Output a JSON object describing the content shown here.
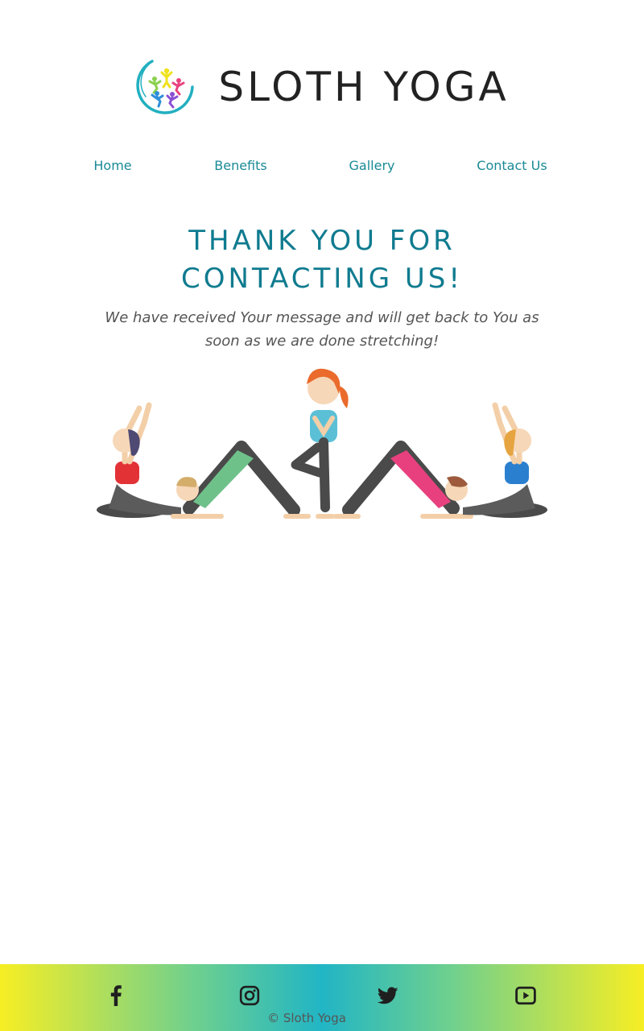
{
  "header": {
    "brand_name": "SLOTH YOGA",
    "logo_icon": "yoga-people-circle-logo"
  },
  "nav": {
    "items": [
      {
        "label": "Home"
      },
      {
        "label": "Benefits"
      },
      {
        "label": "Gallery"
      },
      {
        "label": "Contact Us"
      }
    ]
  },
  "main": {
    "heading": "THANK YOU FOR CONTACTING US!",
    "message": "We have received Your message and will get back to You as soon as we are done stretching!",
    "illustration": "five-women-yoga-poses-illustration"
  },
  "footer": {
    "social_icons": [
      "facebook-icon",
      "instagram-icon",
      "twitter-icon",
      "youtube-icon"
    ],
    "copyright": "© Sloth Yoga"
  },
  "colors": {
    "accent": "#1a8a96",
    "heading": "#0f7b8f",
    "brand_text": "#222222",
    "footer_gradient": [
      "#f7ee24",
      "#6fd08e",
      "#21b5c5"
    ]
  }
}
